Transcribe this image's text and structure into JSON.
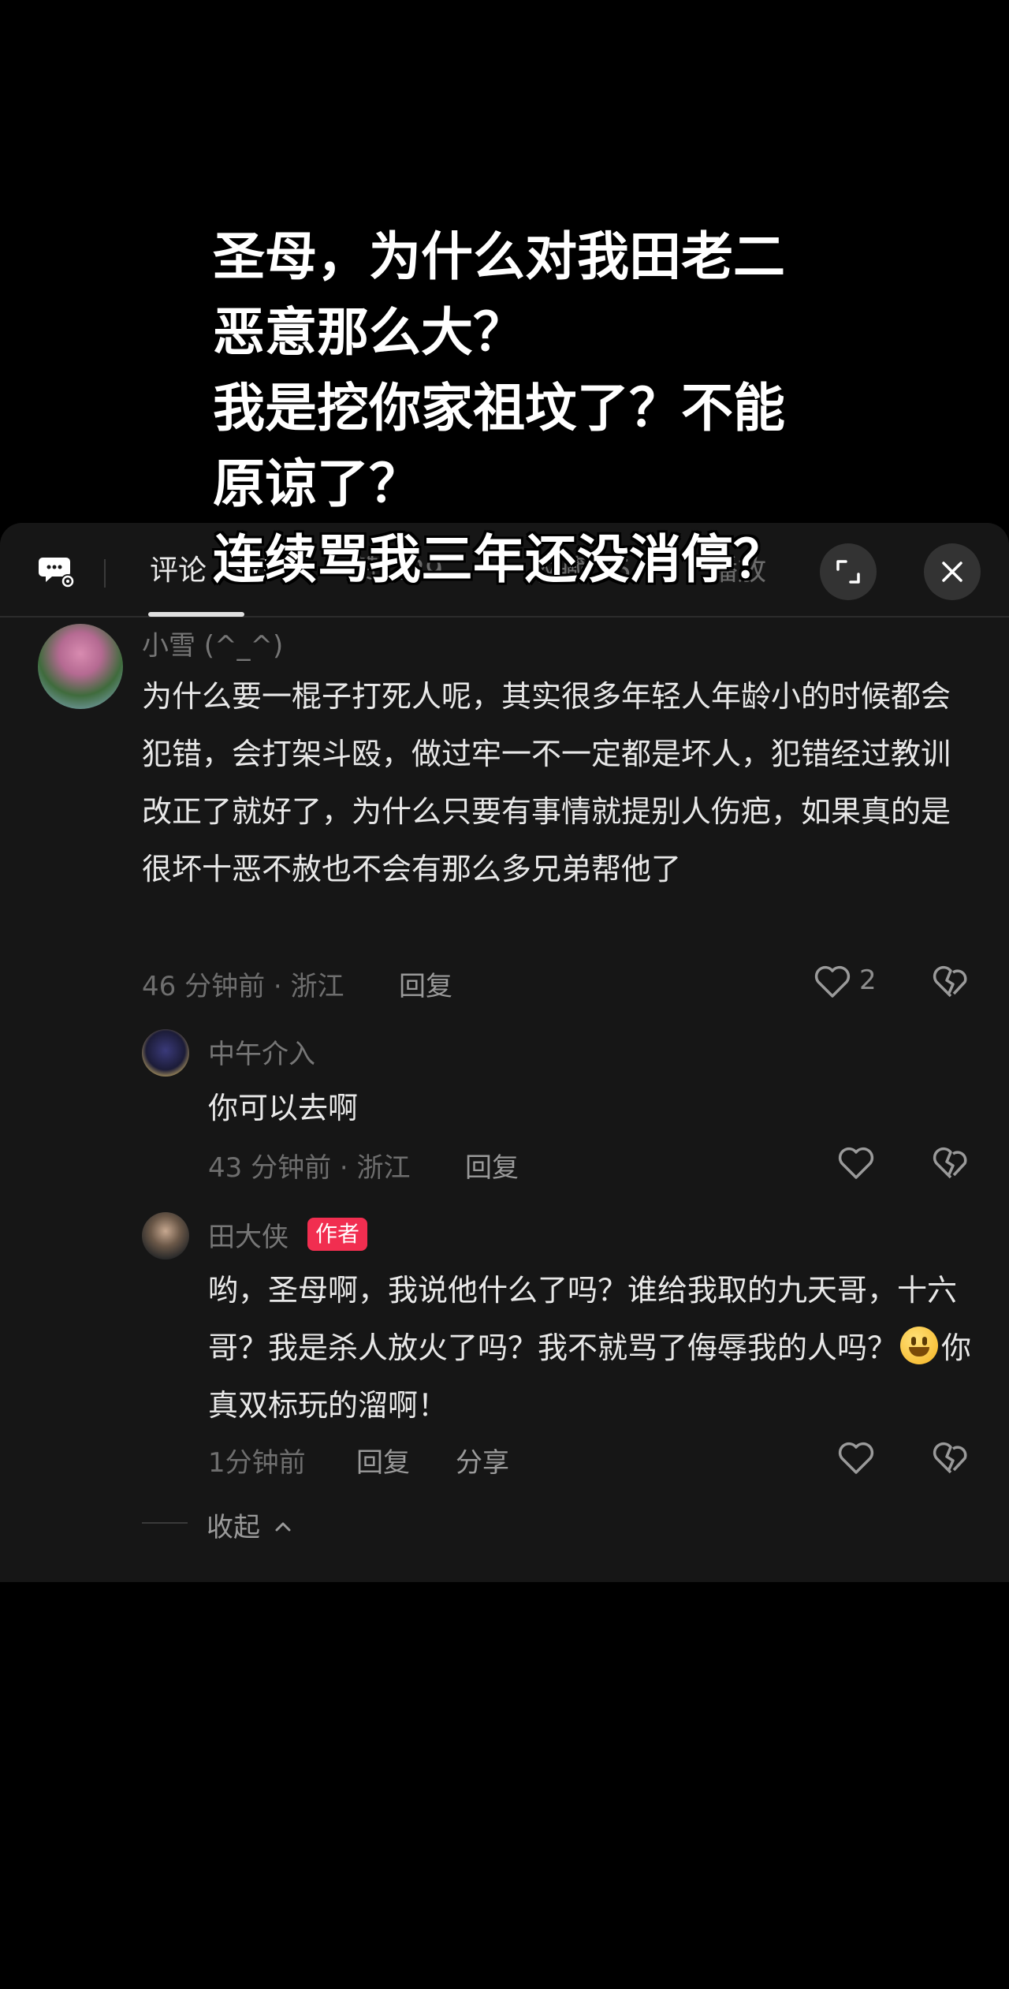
{
  "caption": {
    "lines": [
      "圣母，为什么对我田老二",
      "恶意那么大？",
      "我是挖你家祖坟了？不能",
      "原谅了？",
      "连续骂我三年还没消停？"
    ]
  },
  "tabs": [
    {
      "label": "评论 496"
    },
    {
      "label": "赞 229"
    },
    {
      "label": "收藏 25"
    },
    {
      "label": "播放"
    }
  ],
  "comment": {
    "username": "小雪 (^_^)",
    "text": "为什么要一棍子打死人呢，其实很多年轻人年龄小的时候都会犯错，会打架斗殴，做过牢一不一定都是坏人，犯错经过教训改正了就好了，为什么只要有事情就提别人伤疤，如果真的是很坏十恶不赦也不会有那么多兄弟帮他了",
    "meta": "46 分钟前 · 浙江",
    "reply_label": "回复",
    "like_count": "2"
  },
  "replies": [
    {
      "username": "中午介入",
      "text": "你可以去啊",
      "meta": "43 分钟前 · 浙江",
      "reply_label": "回复"
    },
    {
      "username": "田大侠",
      "badge": "作者",
      "text_before_emoji": "哟，圣母啊，我说他什么了吗？谁给我取的九天哥，十六哥？我是杀人放火了吗？我不就骂了侮辱我的人吗？",
      "text_after_emoji": "你真双标玩的溜啊！",
      "meta": "1分钟前",
      "reply_label": "回复",
      "share_label": "分享"
    }
  ],
  "collapse_label": "收起",
  "icons": [
    "comment-settings-icon",
    "expand-icon",
    "close-icon",
    "heart-icon",
    "broken-heart-icon",
    "chevron-up-icon",
    "smile-emoji"
  ]
}
